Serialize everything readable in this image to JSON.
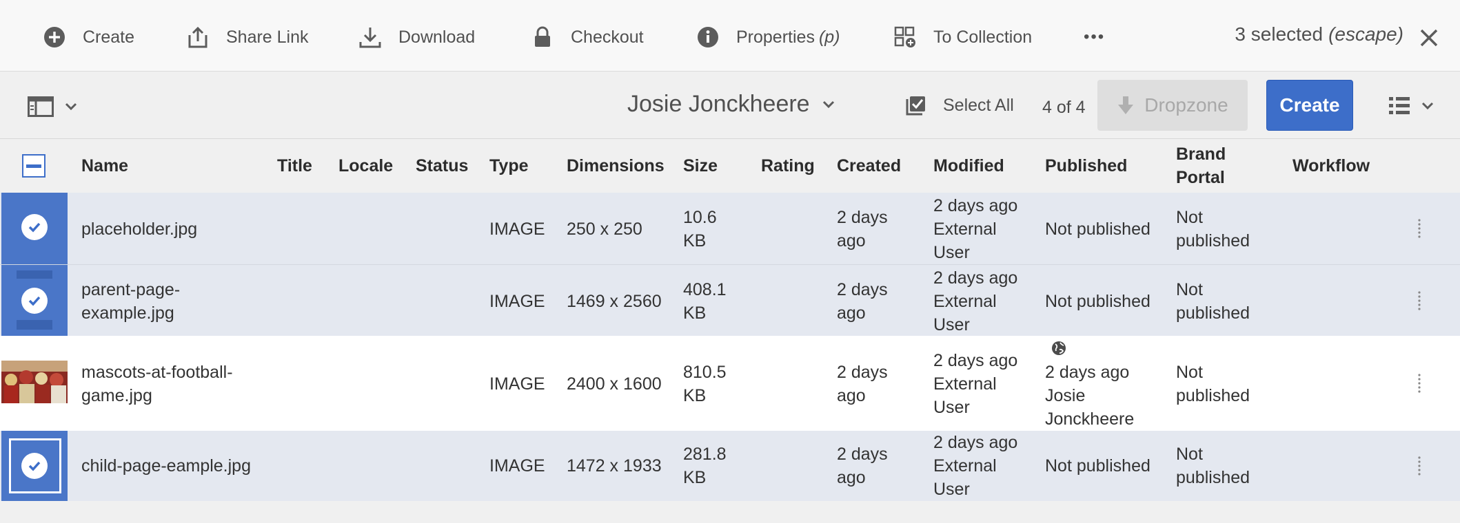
{
  "actionbar": {
    "create": "Create",
    "share_link": "Share Link",
    "download": "Download",
    "checkout": "Checkout",
    "properties": "Properties",
    "properties_shortcut": "(p)",
    "to_collection": "To Collection",
    "more": "•••",
    "selected": "3 selected",
    "selected_hint": "(escape)"
  },
  "toolbar": {
    "owner": "Josie Jonckheere",
    "select_all": "Select All",
    "count": "4 of 4",
    "dropzone": "Dropzone",
    "create": "Create"
  },
  "columns": {
    "name": "Name",
    "title": "Title",
    "locale": "Locale",
    "status": "Status",
    "type": "Type",
    "dimensions": "Dimensions",
    "size": "Size",
    "rating": "Rating",
    "created": "Created",
    "modified": "Modified",
    "published": "Published",
    "brand_portal_1": "Brand",
    "brand_portal_2": "Portal",
    "workflow": "Workflow"
  },
  "rows": [
    {
      "name_1": "placeholder.jpg",
      "name_2": "",
      "type": "IMAGE",
      "dimensions": "250 x 250",
      "size_1": "10.6",
      "size_2": "KB",
      "created_1": "2 days",
      "created_2": "ago",
      "modified_1": "2 days ago",
      "modified_2": "External",
      "modified_3": "User",
      "published": "Not published",
      "brand_1": "Not",
      "brand_2": "published"
    },
    {
      "name_1": "parent-page-",
      "name_2": "example.jpg",
      "type": "IMAGE",
      "dimensions": "1469 x 2560",
      "size_1": "408.1",
      "size_2": "KB",
      "created_1": "2 days",
      "created_2": "ago",
      "modified_1": "2 days ago",
      "modified_2": "External",
      "modified_3": "User",
      "published": "Not published",
      "brand_1": "Not",
      "brand_2": "published"
    },
    {
      "name_1": "mascots-at-football-",
      "name_2": "game.jpg",
      "type": "IMAGE",
      "dimensions": "2400 x 1600",
      "size_1": "810.5",
      "size_2": "KB",
      "created_1": "2 days",
      "created_2": "ago",
      "modified_1": "2 days ago",
      "modified_2": "External",
      "modified_3": "User",
      "published_1": "2 days ago",
      "published_2": "Josie",
      "published_3": "Jonckheere",
      "brand_1": "Not",
      "brand_2": "published"
    },
    {
      "name_1": "child-page-eample.jpg",
      "name_2": "",
      "type": "IMAGE",
      "dimensions": "1472 x 1933",
      "size_1": "281.8",
      "size_2": "KB",
      "created_1": "2 days",
      "created_2": "ago",
      "modified_1": "2 days ago",
      "modified_2": "External",
      "modified_3": "User",
      "published": "Not published",
      "brand_1": "Not",
      "brand_2": "published"
    }
  ],
  "colors": {
    "accent": "#3d6ec9",
    "selected_row": "#e4e8f0"
  }
}
